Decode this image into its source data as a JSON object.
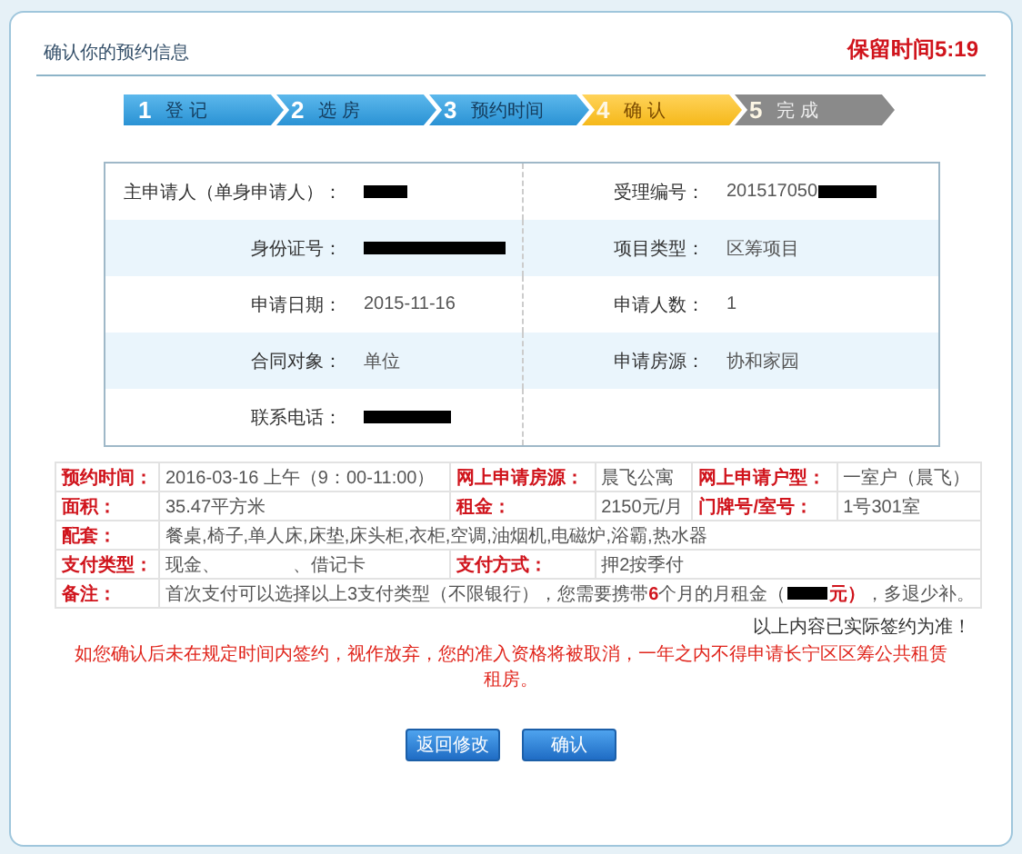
{
  "header": {
    "title": "确认你的预约信息",
    "countdown": "保留时间5:19"
  },
  "steps": [
    {
      "number": "1",
      "label": "登 记",
      "completed": true,
      "selected": false
    },
    {
      "number": "2",
      "label": "选 房",
      "completed": true,
      "selected": false
    },
    {
      "number": "3",
      "label": "预约时间",
      "completed": true,
      "selected": false
    },
    {
      "number": "4",
      "label": "确 认",
      "completed": false,
      "selected": true
    },
    {
      "number": "5",
      "label": "完 成",
      "completed": false,
      "selected": false
    }
  ],
  "applicant_info": [
    [
      {
        "label": "主申请人（单身申请人）：",
        "value": {
          "redacted": true
        }
      },
      {
        "label": "受理编号：",
        "value": {
          "text": "201517050",
          "redacted": true
        }
      }
    ],
    [
      {
        "label": "身份证号：",
        "value": {
          "redacted": true
        }
      },
      {
        "label": "项目类型：",
        "value": {
          "text": "区筹项目"
        }
      }
    ],
    [
      {
        "label": "申请日期：",
        "value": {
          "text": "2015-11-16"
        }
      },
      {
        "label": "申请人数：",
        "value": {
          "text": "1"
        }
      }
    ],
    [
      {
        "label": "合同对象：",
        "value": {
          "text": "单位"
        }
      },
      {
        "label": "申请房源：",
        "value": {
          "text": "协和家园"
        }
      }
    ],
    [
      {
        "label": "联系电话：",
        "value": {
          "redacted": true
        }
      }
    ]
  ],
  "booking_table": [
    [
      {
        "kind": "label",
        "text": "预约时间："
      },
      {
        "kind": "value",
        "text": "2016-03-16 上午（9：00-11:00）"
      },
      {
        "kind": "label",
        "text": "网上申请房源："
      },
      {
        "kind": "value",
        "text": "晨飞公寓"
      },
      {
        "kind": "label",
        "text": "网上申请户型："
      },
      {
        "kind": "value",
        "text": "一室户（晨飞）"
      }
    ],
    [
      {
        "kind": "label",
        "text": "面积："
      },
      {
        "kind": "value",
        "text": "35.47平方米"
      },
      {
        "kind": "label",
        "text": "租金："
      },
      {
        "kind": "value",
        "text": "2150元/月"
      },
      {
        "kind": "label",
        "text": "门牌号/室号："
      },
      {
        "kind": "value",
        "text": "1号301室"
      }
    ],
    [
      {
        "kind": "label",
        "text": "配套："
      },
      {
        "kind": "value",
        "text": "餐桌,椅子,单人床,床垫,床头柜,衣柜,空调,油烟机,电磁炉,浴霸,热水器"
      }
    ],
    [
      {
        "kind": "label",
        "text": "支付类型："
      },
      {
        "kind": "value",
        "text": "现金、",
        "text_after": "、借记卡"
      },
      {
        "kind": "label",
        "text": "支付方式："
      },
      {
        "kind": "value",
        "text": "押2按季付"
      }
    ]
  ],
  "remark": {
    "label": "备注：",
    "parts": [
      {
        "kind": "text",
        "text": "首次支付可以选择以上3支付类型（不限银行），您需要携带",
        "emphasis": false
      },
      {
        "kind": "text",
        "text": "6",
        "emphasis": true
      },
      {
        "kind": "text",
        "text": "个月的月租金（",
        "emphasis": false
      },
      {
        "kind": "redaction"
      },
      {
        "kind": "text",
        "text": "元）",
        "emphasis": true
      },
      {
        "kind": "text",
        "text": "，多退少补。",
        "emphasis": false
      }
    ]
  },
  "notice": "以上内容已实际签约为准！",
  "warning": "如您确认后未在规定时间内签约，视作放弃，您的准入资格将被取消，一年之内不得申请长宁区区筹公共租赁租房。",
  "buttons": [
    {
      "label": "返回修改"
    },
    {
      "label": "确认"
    }
  ]
}
